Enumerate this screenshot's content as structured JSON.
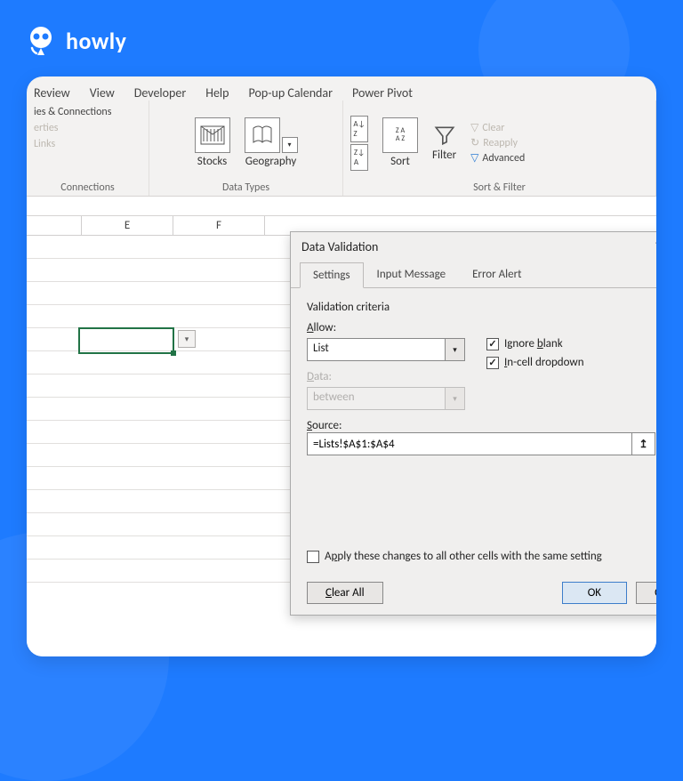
{
  "brand": {
    "name": "howly"
  },
  "ribbon": {
    "tabs": [
      "Review",
      "View",
      "Developer",
      "Help",
      "Pop-up Calendar",
      "Power Pivot"
    ],
    "connections": {
      "item1": "ies & Connections",
      "item2": "erties",
      "item3": "Links",
      "group_label": "Connections"
    },
    "datatypes": {
      "stocks": "Stocks",
      "geography": "Geography",
      "group_label": "Data Types"
    },
    "sortfilter": {
      "sort": "Sort",
      "filter": "Filter",
      "clear": "Clear",
      "reapply": "Reapply",
      "advanced": "Advanced",
      "group_label": "Sort & Filter"
    }
  },
  "grid": {
    "cols": [
      "E",
      "F"
    ]
  },
  "dialog": {
    "title": "Data Validation",
    "help": "?",
    "tabs": {
      "settings": "Settings",
      "input": "Input Message",
      "error": "Error Alert"
    },
    "criteria_label": "Validation criteria",
    "allow_label": "Allow:",
    "allow_value": "List",
    "data_label": "Data:",
    "data_value": "between",
    "ignore_blank": "Ignore blank",
    "incell": "In-cell dropdown",
    "source_label": "Source:",
    "source_value": "=Lists!$A$1:$A$4",
    "apply": "Apply these changes to all other cells with the same setting",
    "clear_all": "Clear All",
    "ok": "OK",
    "cancel": "C"
  }
}
